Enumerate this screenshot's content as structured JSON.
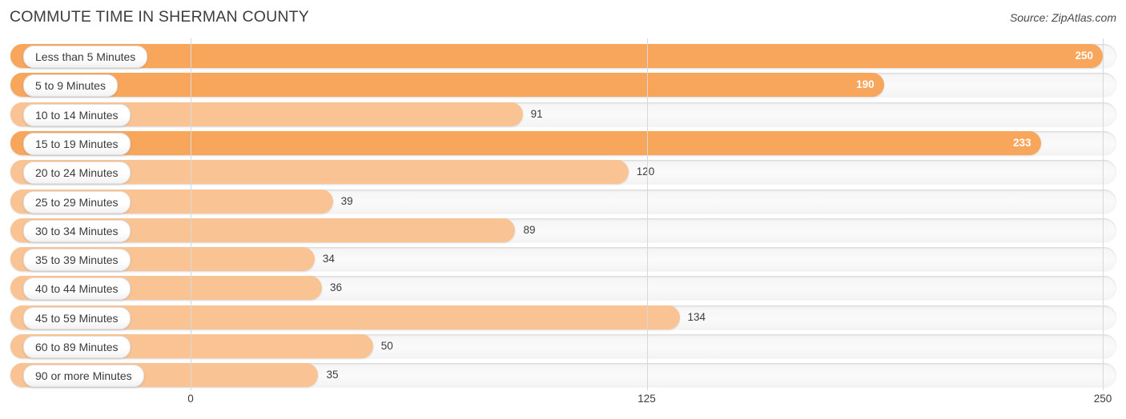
{
  "header": {
    "title": "COMMUTE TIME IN SHERMAN COUNTY",
    "source": "Source: ZipAtlas.com"
  },
  "colors": {
    "bar_dark": "#f8a65c",
    "bar_light": "#f9c394",
    "track": "#f7f7f7",
    "gridline": "#d8d8d8",
    "text": "#3c3c3c",
    "inner_label": "#ffffff"
  },
  "chart_data": {
    "type": "bar",
    "orientation": "horizontal",
    "title": "COMMUTE TIME IN SHERMAN COUNTY",
    "subtitle": "",
    "xlabel": "",
    "ylabel": "",
    "source": "Source: ZipAtlas.com",
    "xlim": [
      0,
      250
    ],
    "ticks": [
      "0",
      "125",
      "250"
    ],
    "tick_values": [
      0,
      125,
      250
    ],
    "grid": true,
    "legend": false,
    "categories": [
      "Less than 5 Minutes",
      "5 to 9 Minutes",
      "10 to 14 Minutes",
      "15 to 19 Minutes",
      "20 to 24 Minutes",
      "25 to 29 Minutes",
      "30 to 34 Minutes",
      "35 to 39 Minutes",
      "40 to 44 Minutes",
      "45 to 59 Minutes",
      "60 to 89 Minutes",
      "90 or more Minutes"
    ],
    "values": [
      250,
      190,
      91,
      233,
      120,
      39,
      89,
      34,
      36,
      134,
      50,
      35
    ],
    "value_labels": [
      "250",
      "190",
      "91",
      "233",
      "120",
      "39",
      "89",
      "34",
      "36",
      "134",
      "50",
      "35"
    ],
    "bars": [
      {
        "label": "Less than 5 Minutes",
        "value": 250,
        "display": "250",
        "shade": "dark",
        "label_inside": true
      },
      {
        "label": "5 to 9 Minutes",
        "value": 190,
        "display": "190",
        "shade": "dark",
        "label_inside": true
      },
      {
        "label": "10 to 14 Minutes",
        "value": 91,
        "display": "91",
        "shade": "light",
        "label_inside": false
      },
      {
        "label": "15 to 19 Minutes",
        "value": 233,
        "display": "233",
        "shade": "dark",
        "label_inside": true
      },
      {
        "label": "20 to 24 Minutes",
        "value": 120,
        "display": "120",
        "shade": "light",
        "label_inside": false
      },
      {
        "label": "25 to 29 Minutes",
        "value": 39,
        "display": "39",
        "shade": "light",
        "label_inside": false
      },
      {
        "label": "30 to 34 Minutes",
        "value": 89,
        "display": "89",
        "shade": "light",
        "label_inside": false
      },
      {
        "label": "35 to 39 Minutes",
        "value": 34,
        "display": "34",
        "shade": "light",
        "label_inside": false
      },
      {
        "label": "40 to 44 Minutes",
        "value": 36,
        "display": "36",
        "shade": "light",
        "label_inside": false
      },
      {
        "label": "45 to 59 Minutes",
        "value": 134,
        "display": "134",
        "shade": "light",
        "label_inside": false
      },
      {
        "label": "60 to 89 Minutes",
        "value": 50,
        "display": "50",
        "shade": "light",
        "label_inside": false
      },
      {
        "label": "90 or more Minutes",
        "value": 35,
        "display": "35",
        "shade": "light",
        "label_inside": false
      }
    ]
  }
}
